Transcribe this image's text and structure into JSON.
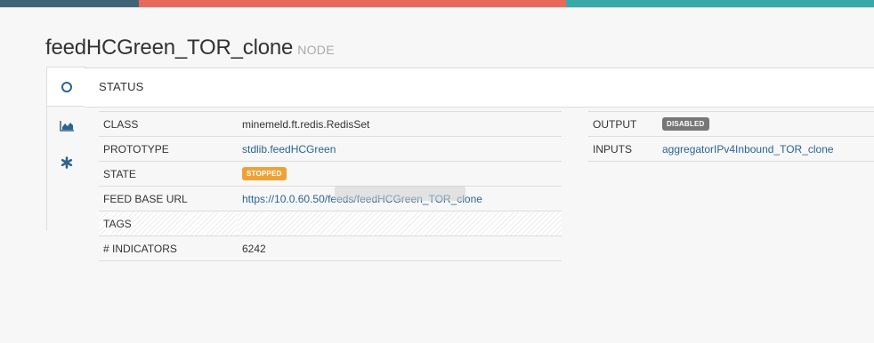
{
  "colors": {
    "bar_dark": "#3f6478",
    "bar_red": "#e8685c",
    "bar_teal": "#3aa7a8",
    "link": "#2c6491",
    "badge_stopped": "#eea236",
    "badge_disabled": "#777777"
  },
  "header": {
    "node_name": "feedHCGreen_TOR_clone",
    "node_type": "NODE"
  },
  "tabs": [
    {
      "icon": "circle-icon",
      "active": true
    },
    {
      "icon": "area-chart-icon",
      "active": false
    },
    {
      "icon": "asterisk-icon",
      "active": false
    }
  ],
  "panel": {
    "title": "STATUS"
  },
  "left_table": {
    "class_label": "CLASS",
    "class_value": "minemeld.ft.redis.RedisSet",
    "prototype_label": "PROTOTYPE",
    "prototype_value": "stdlib.feedHCGreen",
    "state_label": "STATE",
    "state_value": "STOPPED",
    "feed_url_label": "FEED BASE URL",
    "feed_url_value": "https://10.0.60.50/feeds/feedHCGreen_TOR_clone",
    "tags_label": "TAGS",
    "indicators_label": "# INDICATORS",
    "indicators_value": "6242"
  },
  "right_table": {
    "output_label": "OUTPUT",
    "output_value": "DISABLED",
    "inputs_label": "INPUTS",
    "inputs_value": "aggregatorIPv4Inbound_TOR_clone"
  }
}
